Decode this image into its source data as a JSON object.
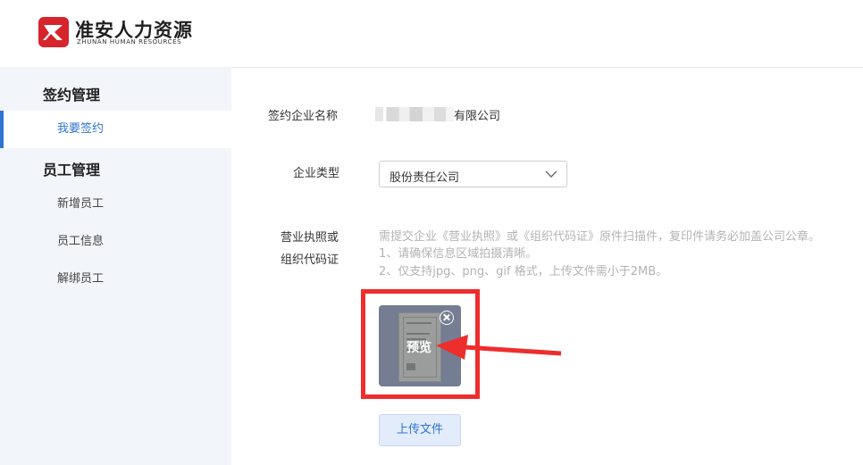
{
  "brand": {
    "name_cn": "准安人力资源",
    "name_en": "ZHUNAN HUMAN RESOURCES"
  },
  "sidebar": {
    "groups": [
      {
        "title": "签约管理",
        "items": [
          {
            "label": "我要签约",
            "active": true
          }
        ]
      },
      {
        "title": "员工管理",
        "items": [
          {
            "label": "新增员工"
          },
          {
            "label": "员工信息"
          },
          {
            "label": "解绑员工"
          }
        ]
      }
    ]
  },
  "form": {
    "company_name_label": "签约企业名称",
    "company_name_value_suffix": "有限公司",
    "company_type_label": "企业类型",
    "company_type_value": "股份责任公司",
    "license_label_line1": "营业执照或",
    "license_label_line2": "组织代码证",
    "hints": [
      "需提交企业《营业执照》或《组织代码证》原件扫描件，复印件请务必加盖公司公章。",
      "1、请确保信息区域拍摄清晰。",
      "2、仅支持jpg、png、gif 格式，上传文件需小于2MB。"
    ],
    "preview_label": "预览",
    "upload_button": "上传文件"
  },
  "colors": {
    "accent": "#2f74d0",
    "highlight": "#ee2d2d",
    "brand_red": "#d7232b",
    "sidebar_bg": "#f2f5fa"
  },
  "icons": {
    "close": "close-circle-icon",
    "dropdown": "chevron-down-icon",
    "logo": "brand-logo-icon",
    "annotation": "red-arrow-icon"
  }
}
